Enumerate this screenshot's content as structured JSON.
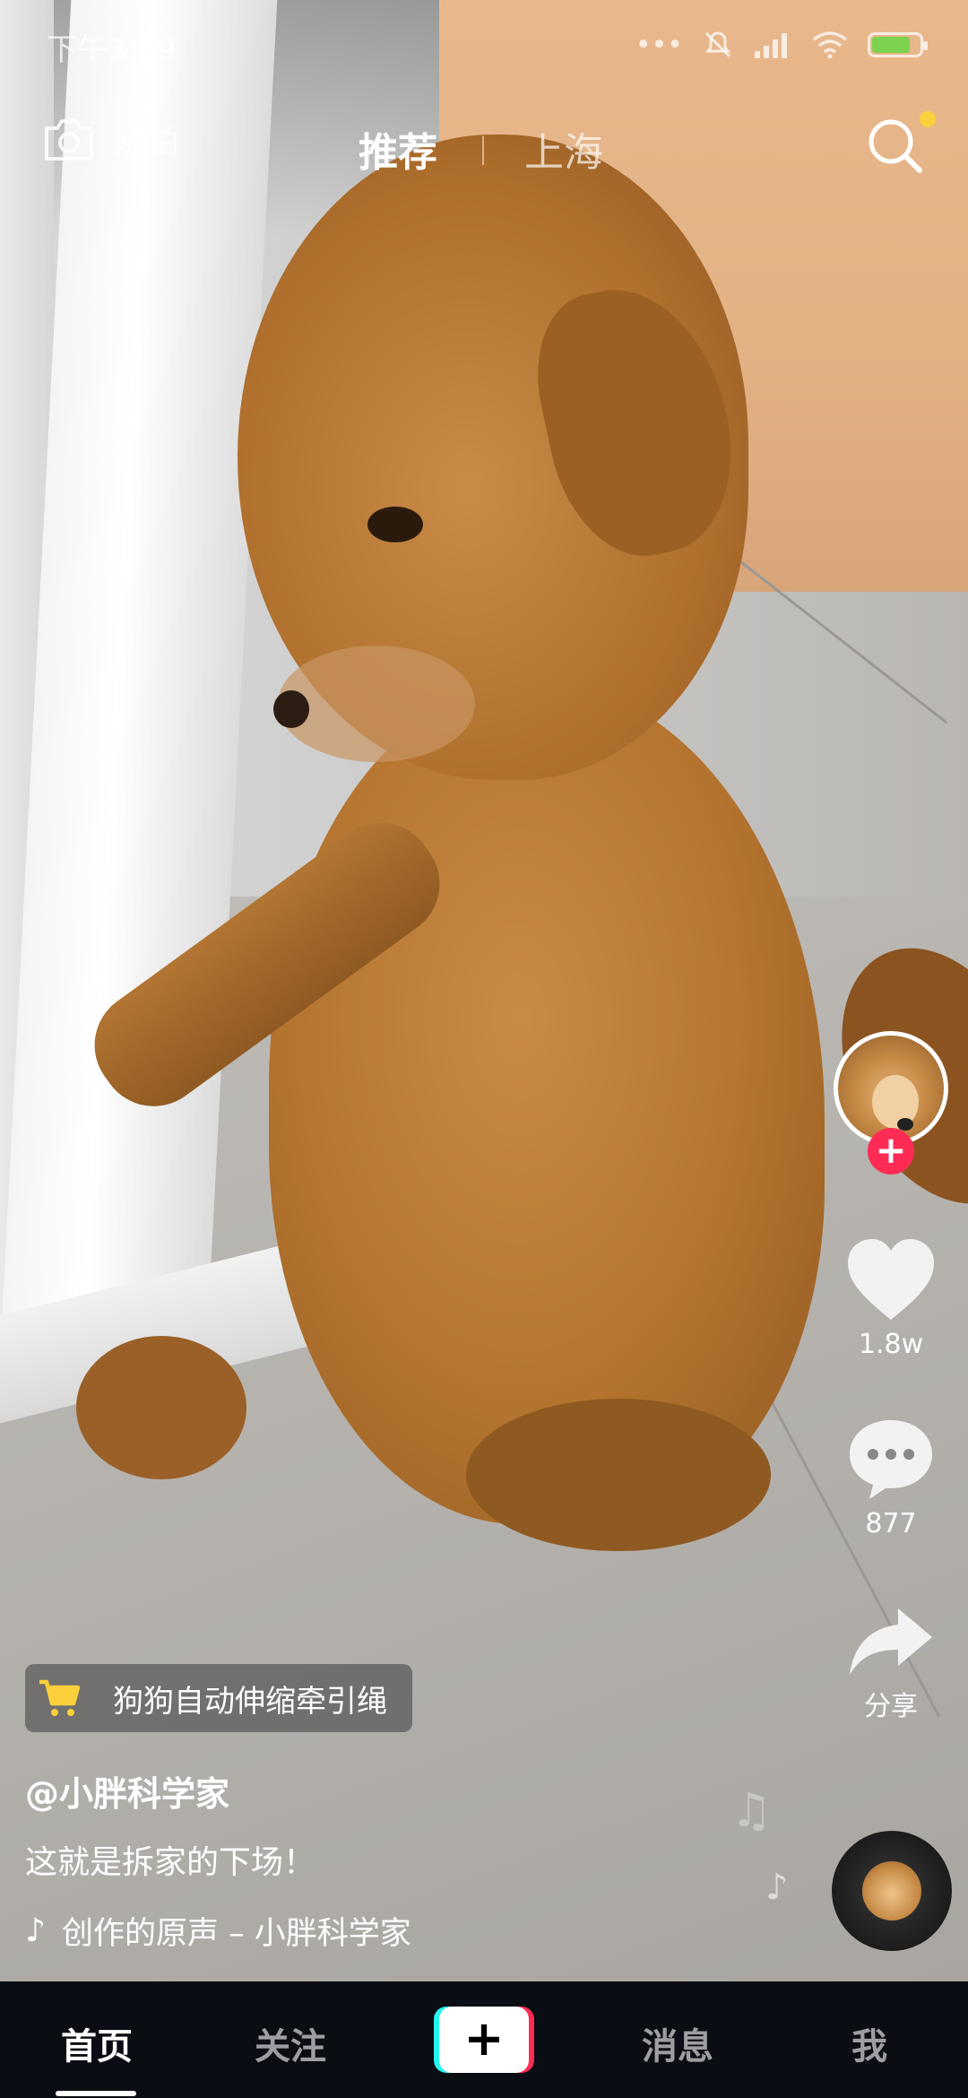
{
  "status_bar": {
    "time": "下午3:19",
    "dots": "•••",
    "battery_level_percent": 80
  },
  "top_nav": {
    "camera_label": "随拍",
    "tabs": [
      {
        "label": "推荐",
        "active": true
      },
      {
        "label": "上海",
        "active": false
      }
    ],
    "search_has_notification": true
  },
  "actions": {
    "like_count": "1.8w",
    "comment_count": "877",
    "share_label": "分享"
  },
  "post": {
    "product_tag": "狗狗自动伸缩牵引绳",
    "author": "@小胖科学家",
    "caption": "这就是拆家的下场！",
    "sound": "创作的原声 – 小胖科学家"
  },
  "bottom_nav": {
    "items": [
      {
        "label": "首页",
        "active": true
      },
      {
        "label": "关注",
        "active": false
      },
      {
        "label": "消息",
        "active": false
      },
      {
        "label": "我",
        "active": false
      }
    ],
    "plus_label": "+"
  },
  "colors": {
    "accent_red": "#fe2c55",
    "accent_cyan": "#25f4ee",
    "notification_dot": "#fbd03c",
    "cart_icon": "#fbd03c",
    "nav_background": "#0b0d14"
  }
}
